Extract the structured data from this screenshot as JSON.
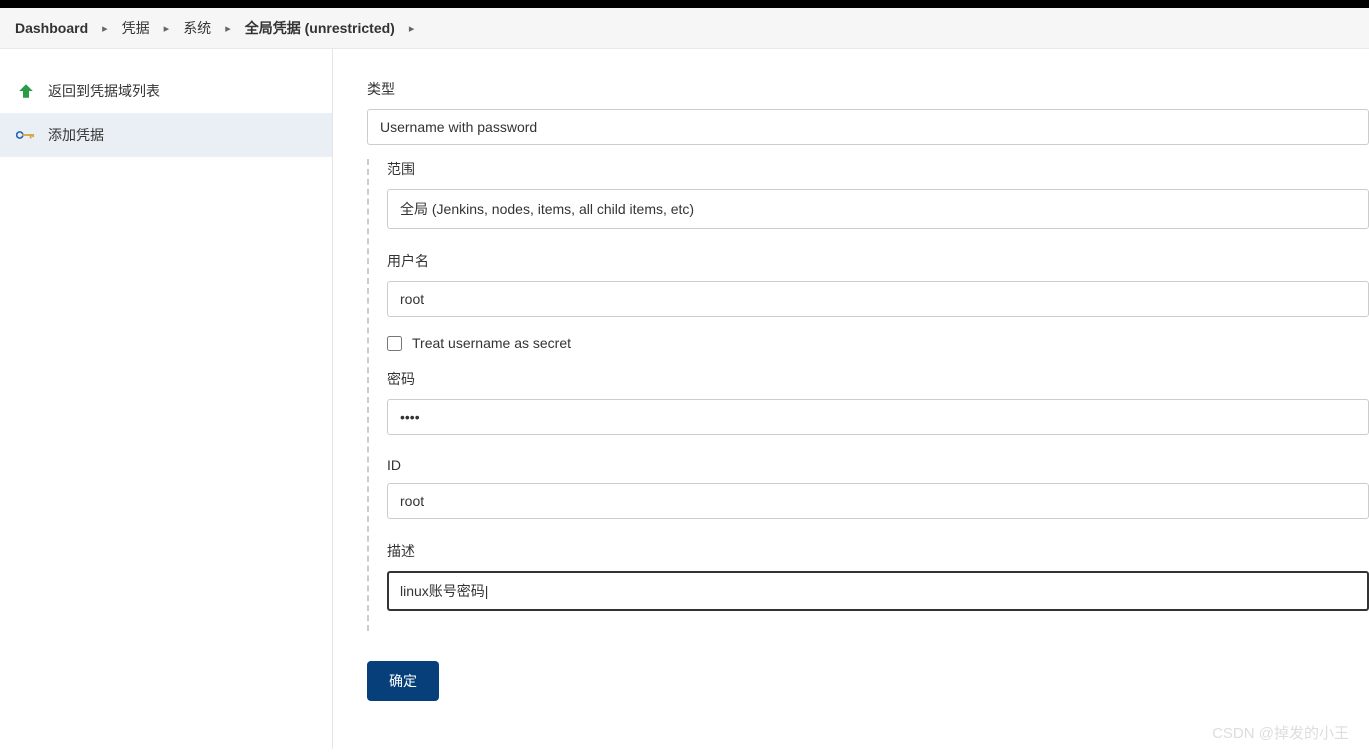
{
  "breadcrumb": {
    "items": [
      {
        "label": "Dashboard",
        "bold": true
      },
      {
        "label": "凭据",
        "bold": false
      },
      {
        "label": "系统",
        "bold": false
      },
      {
        "label": "全局凭据 (unrestricted)",
        "bold": true
      }
    ]
  },
  "sidebar": {
    "items": [
      {
        "label": "返回到凭据域列表",
        "icon": "up-arrow-icon"
      },
      {
        "label": "添加凭据",
        "icon": "key-icon"
      }
    ]
  },
  "form": {
    "type_label": "类型",
    "type_value": "Username with password",
    "scope_label": "范围",
    "scope_value": "全局 (Jenkins, nodes, items, all child items, etc)",
    "username_label": "用户名",
    "username_value": "root",
    "treat_secret_label": "Treat username as secret",
    "treat_secret_checked": false,
    "password_label": "密码",
    "password_value": "••••",
    "id_label": "ID",
    "id_value": "root",
    "description_label": "描述",
    "description_value": "linux账号密码",
    "submit_label": "确定"
  },
  "watermark": "CSDN @掉发的小王"
}
